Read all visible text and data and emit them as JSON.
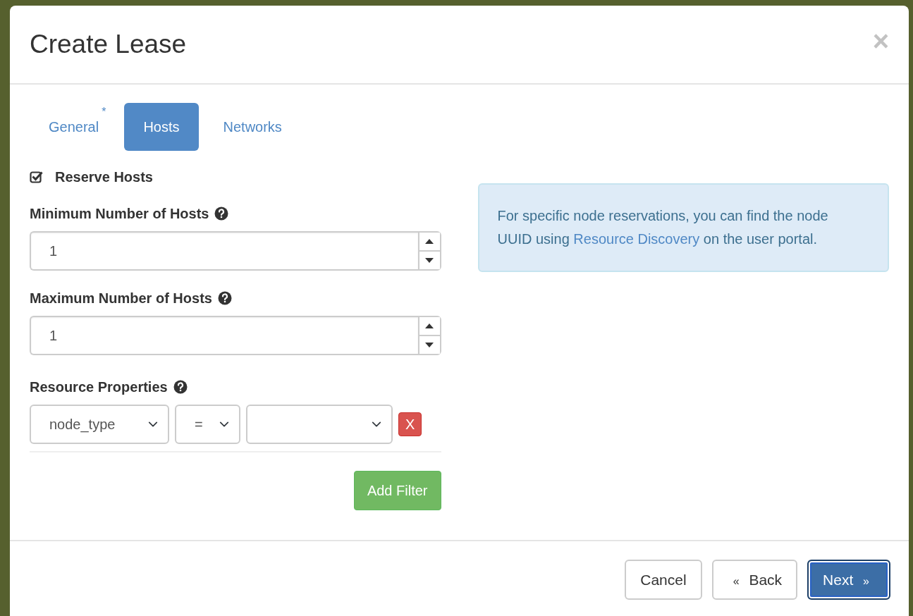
{
  "dialog": {
    "title": "Create Lease",
    "close_label": "×"
  },
  "tabs": [
    {
      "label": "General",
      "required_mark": "*",
      "selected": false
    },
    {
      "label": "Hosts",
      "selected": true
    },
    {
      "label": "Networks",
      "selected": false
    }
  ],
  "reserve_hosts": {
    "label": "Reserve Hosts",
    "checked": true
  },
  "fields": [
    {
      "label": "Minimum Number of Hosts",
      "value": "1"
    },
    {
      "label": "Maximum Number of Hosts",
      "value": "1"
    }
  ],
  "resource_properties": {
    "label": "Resource Properties",
    "filters": [
      {
        "attribute": "node_type",
        "operator": "=",
        "remove_label": "X"
      }
    ],
    "add_label": "Add Filter"
  },
  "info": {
    "text_before": "For specific node reservations, you can find the node UUID using",
    "link": "Resource Discovery",
    "text_after": "on the user portal."
  },
  "footer_buttons": [
    {
      "label": "Cancel",
      "kind": "plain"
    },
    {
      "label": "Back",
      "arrow": "«",
      "kind": "back"
    },
    {
      "label": "Next",
      "arrow": "»",
      "kind": "primary"
    }
  ]
}
